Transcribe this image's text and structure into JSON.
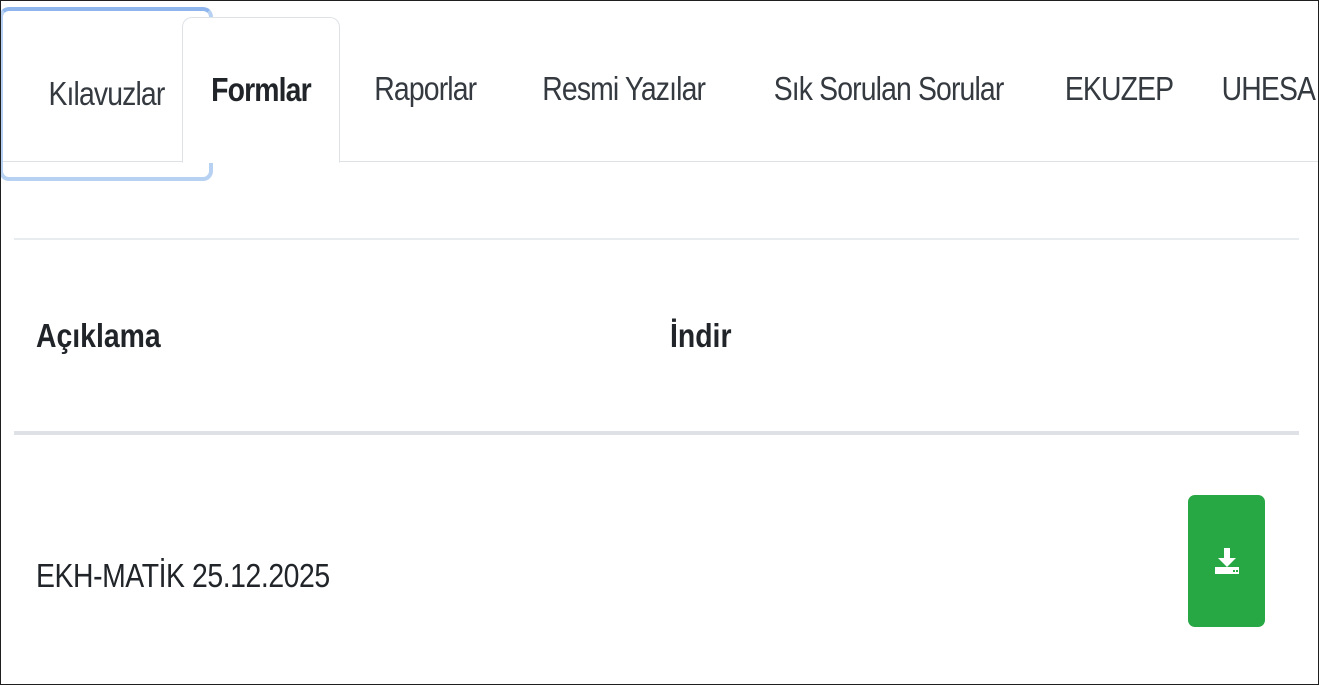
{
  "tabs": [
    {
      "label": "Kılavuzlar",
      "state": "focused"
    },
    {
      "label": "Formlar",
      "state": "active"
    },
    {
      "label": "Raporlar",
      "state": "inactive"
    },
    {
      "label": "Resmi Yazılar",
      "state": "inactive"
    },
    {
      "label": "Sık Sorulan Sorular",
      "state": "inactive"
    },
    {
      "label": "EKUZEP",
      "state": "inactive"
    },
    {
      "label": "UHESA",
      "state": "inactive"
    }
  ],
  "table": {
    "columns": [
      "Açıklama",
      "İndir"
    ],
    "rows": [
      {
        "description": "EKH-MATİK 25.12.2025",
        "action_icon": "download-icon"
      }
    ]
  },
  "colors": {
    "download_button": "#28a745",
    "focus_ring": "#b7d1f3",
    "border": "#dee2e6"
  }
}
